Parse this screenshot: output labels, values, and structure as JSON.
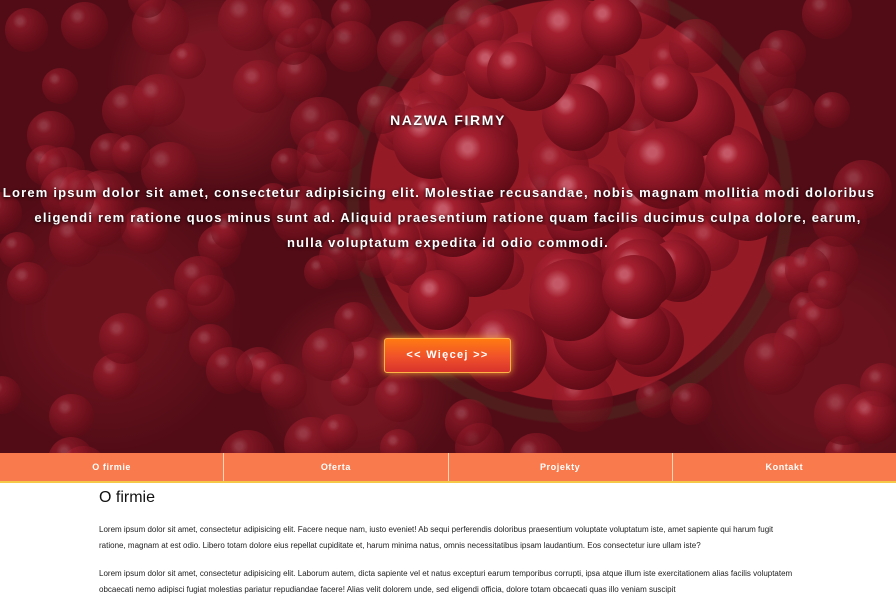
{
  "hero": {
    "company_name": "NAZWA FIRMY",
    "lead_line1": "Lorem ipsum dolor sit amet, consectetur adipisicing elit. Molestiae recusandae, nobis magnam mollitia modi doloribus",
    "lead_line2": "eligendi rem ratione quos minus sunt ad. Aliquid praesentium ratione quam facilis ducimus culpa dolore, earum,",
    "lead_line3": "nulla voluptatum expedita id odio commodi.",
    "button_label": "<<  Więcej  >>",
    "image": "cranberries-photo"
  },
  "nav": {
    "items": [
      "O firmie",
      "Oferta",
      "Projekty",
      "Kontakt"
    ]
  },
  "content": {
    "title": "O firmie",
    "paragraph1": "Lorem ipsum dolor sit amet, consectetur adipisicing elit. Facere neque nam, iusto eveniet! Ab sequi perferendis doloribus praesentium voluptate voluptatum iste, amet sapiente qui harum fugit ratione, magnam at est odio. Libero totam dolore eius repellat cupiditate et, harum minima natus, omnis necessitatibus ipsam laudantium. Eos consectetur iure ullam iste?",
    "paragraph2": "Lorem ipsum dolor sit amet, consectetur adipisicing elit. Laborum autem, dicta sapiente vel et natus excepturi earum temporibus corrupti, ipsa atque illum iste exercitationem alias facilis voluptatem obcaecati nemo adipisci fugiat molestias pariatur repudiandae facere! Alias velit dolorem unde, sed eligendi officia, dolore totam obcaecati quas illo veniam suscipit"
  },
  "colors": {
    "nav_bg": "#f97a4c",
    "button": "#f0502a",
    "accent_line": "#f5c84a"
  }
}
